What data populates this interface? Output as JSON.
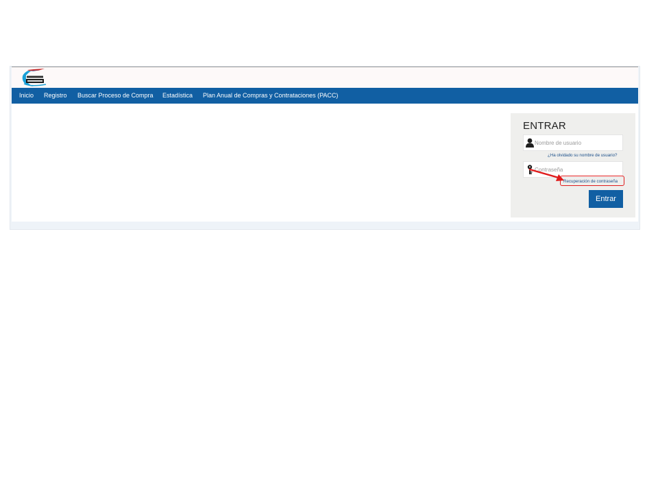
{
  "nav": {
    "items": [
      {
        "label": "Inicio"
      },
      {
        "label": "Registro"
      },
      {
        "label": "Buscar Proceso de Compra"
      },
      {
        "label": "Estadística"
      },
      {
        "label": "Plan Anual de Compras y Contrataciones (PACC)"
      }
    ]
  },
  "login": {
    "title": "ENTRAR",
    "username_placeholder": "Nombre de usuario",
    "username_value": "",
    "forgot_username": "¿Ha olvidado su nombre de usuario?",
    "password_placeholder": "Contraseña",
    "password_value": "",
    "password_recovery": "Recuperación de contraseña",
    "submit_label": "Entrar"
  },
  "colors": {
    "navbar": "#115fa3",
    "button": "#115fa3",
    "highlight": "#e01b1b",
    "login_panel": "#efefed"
  },
  "icons": {
    "logo": "compras-logo",
    "user": "user-icon",
    "key": "key-icon",
    "annotation": "red-arrow-icon"
  }
}
